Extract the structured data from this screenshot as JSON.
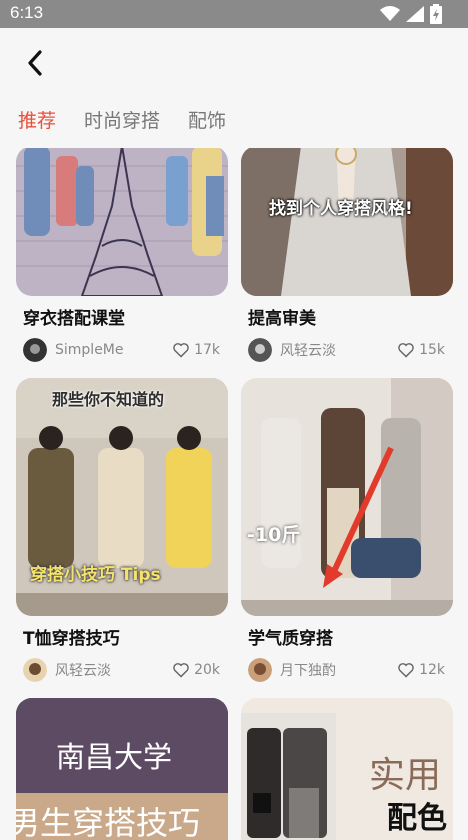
{
  "status_bar": {
    "time": "6:13"
  },
  "tabs": [
    {
      "label": "推荐",
      "active": true
    },
    {
      "label": "时尚穿搭",
      "active": false
    },
    {
      "label": "配饰",
      "active": false
    }
  ],
  "colors": {
    "accent": "#e8503c",
    "background": "#f6f6f6"
  },
  "cards": [
    {
      "title": "穿衣搭配课堂",
      "author": "SimpleMe",
      "likes": "17k"
    },
    {
      "title": "提高审美",
      "author": "风轻云淡",
      "likes": "15k",
      "overlay": "找到个人穿搭风格!"
    },
    {
      "title": "T恤穿搭技巧",
      "author": "风轻云淡",
      "likes": "20k",
      "overlay_top": "那些你不知道的",
      "overlay_bottom": "穿搭小技巧 Tips"
    },
    {
      "title": "学气质穿搭",
      "author": "月下独酌",
      "likes": "12k",
      "overlay": "-10斤"
    },
    {
      "overlay_top": "南昌大学",
      "overlay_bottom": "男生穿搭技巧"
    },
    {
      "overlay_top": "实用",
      "overlay_bottom": "配色"
    }
  ],
  "icons": {
    "back": "back-arrow-icon",
    "like": "heart-icon",
    "wifi": "wifi-icon",
    "signal": "signal-icon",
    "battery": "battery-icon"
  }
}
